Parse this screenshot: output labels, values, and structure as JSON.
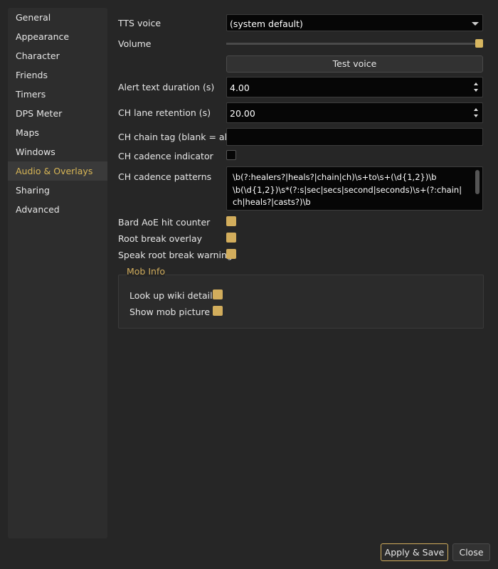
{
  "sidebar": {
    "items": [
      {
        "label": "General"
      },
      {
        "label": "Appearance"
      },
      {
        "label": "Character"
      },
      {
        "label": "Friends"
      },
      {
        "label": "Timers"
      },
      {
        "label": "DPS Meter"
      },
      {
        "label": "Maps"
      },
      {
        "label": "Windows"
      },
      {
        "label": "Audio & Overlays"
      },
      {
        "label": "Sharing"
      },
      {
        "label": "Advanced"
      }
    ],
    "active": "Audio & Overlays"
  },
  "form": {
    "tts_voice": {
      "label": "TTS voice",
      "value": "(system default)"
    },
    "volume": {
      "label": "Volume",
      "level": 1.0
    },
    "test_voice": {
      "label": "Test voice"
    },
    "alert_duration": {
      "label": "Alert text duration (s)",
      "value": "4.00"
    },
    "lane_retention": {
      "label": "CH lane retention (s)",
      "value": "20.00"
    },
    "chain_tag": {
      "label": "CH chain tag (blank = all)",
      "value": ""
    },
    "cadence_indicator": {
      "label": "CH cadence indicator",
      "checked": false
    },
    "cadence_patterns": {
      "label": "CH cadence patterns",
      "lines": [
        "\\b(?:healers?|heals?|chain|ch)\\s+to\\s+(\\d{1,2})\\b",
        "\\b(\\d{1,2})\\s*(?:s|sec|secs|second|seconds)\\s+(?:chain|",
        "ch|heals?|casts?)\\b"
      ]
    },
    "bard_aoe": {
      "label": "Bard AoE hit counter",
      "checked": true
    },
    "root_break_overlay": {
      "label": "Root break overlay",
      "checked": true
    },
    "speak_root_break": {
      "label": "Speak root break warning",
      "checked": true
    }
  },
  "mob_info": {
    "title": "Mob Info",
    "wiki": {
      "label": "Look up wiki details",
      "checked": true
    },
    "picture": {
      "label": "Show mob picture",
      "checked": true
    }
  },
  "footer": {
    "apply_label": "Apply & Save",
    "close_label": "Close"
  },
  "colors": {
    "accent": "#d2ad5c",
    "background": "#262626",
    "sidebar": "#2d2d2d"
  }
}
